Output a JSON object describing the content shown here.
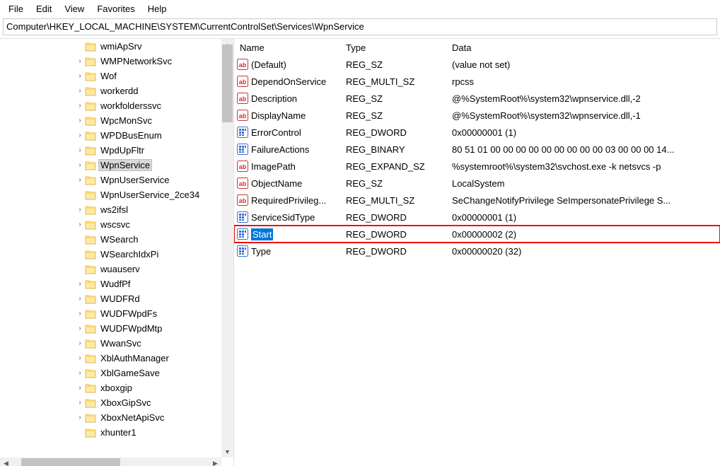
{
  "menubar": {
    "file": "File",
    "edit": "Edit",
    "view": "View",
    "favorites": "Favorites",
    "help": "Help"
  },
  "addressbar": {
    "path": "Computer\\HKEY_LOCAL_MACHINE\\SYSTEM\\CurrentControlSet\\Services\\WpnService"
  },
  "columns": {
    "name": "Name",
    "type": "Type",
    "data": "Data"
  },
  "tree": [
    {
      "label": "wmiApSrv",
      "expander": ""
    },
    {
      "label": "WMPNetworkSvc",
      "expander": ">"
    },
    {
      "label": "Wof",
      "expander": ">"
    },
    {
      "label": "workerdd",
      "expander": ">"
    },
    {
      "label": "workfolderssvc",
      "expander": ">"
    },
    {
      "label": "WpcMonSvc",
      "expander": ">"
    },
    {
      "label": "WPDBusEnum",
      "expander": ">"
    },
    {
      "label": "WpdUpFltr",
      "expander": ">"
    },
    {
      "label": "WpnService",
      "expander": ">",
      "selected": true
    },
    {
      "label": "WpnUserService",
      "expander": ">"
    },
    {
      "label": "WpnUserService_2ce34",
      "expander": ""
    },
    {
      "label": "ws2ifsl",
      "expander": ">"
    },
    {
      "label": "wscsvc",
      "expander": ">"
    },
    {
      "label": "WSearch",
      "expander": ""
    },
    {
      "label": "WSearchIdxPi",
      "expander": ""
    },
    {
      "label": "wuauserv",
      "expander": ""
    },
    {
      "label": "WudfPf",
      "expander": ">"
    },
    {
      "label": "WUDFRd",
      "expander": ">"
    },
    {
      "label": "WUDFWpdFs",
      "expander": ">"
    },
    {
      "label": "WUDFWpdMtp",
      "expander": ">"
    },
    {
      "label": "WwanSvc",
      "expander": ">"
    },
    {
      "label": "XblAuthManager",
      "expander": ">"
    },
    {
      "label": "XblGameSave",
      "expander": ">"
    },
    {
      "label": "xboxgip",
      "expander": ">"
    },
    {
      "label": "XboxGipSvc",
      "expander": ">"
    },
    {
      "label": "XboxNetApiSvc",
      "expander": ">"
    },
    {
      "label": "xhunter1",
      "expander": ""
    }
  ],
  "values": [
    {
      "name": "(Default)",
      "type": "REG_SZ",
      "data": "(value not set)",
      "icon": "ab"
    },
    {
      "name": "DependOnService",
      "type": "REG_MULTI_SZ",
      "data": "rpcss",
      "icon": "ab"
    },
    {
      "name": "Description",
      "type": "REG_SZ",
      "data": "@%SystemRoot%\\system32\\wpnservice.dll,-2",
      "icon": "ab"
    },
    {
      "name": "DisplayName",
      "type": "REG_SZ",
      "data": "@%SystemRoot%\\system32\\wpnservice.dll,-1",
      "icon": "ab"
    },
    {
      "name": "ErrorControl",
      "type": "REG_DWORD",
      "data": "0x00000001 (1)",
      "icon": "bin"
    },
    {
      "name": "FailureActions",
      "type": "REG_BINARY",
      "data": "80 51 01 00 00 00 00 00 00 00 00 00 03 00 00 00 14...",
      "icon": "bin"
    },
    {
      "name": "ImagePath",
      "type": "REG_EXPAND_SZ",
      "data": "%systemroot%\\system32\\svchost.exe -k netsvcs -p",
      "icon": "ab"
    },
    {
      "name": "ObjectName",
      "type": "REG_SZ",
      "data": "LocalSystem",
      "icon": "ab"
    },
    {
      "name": "RequiredPrivileg...",
      "type": "REG_MULTI_SZ",
      "data": "SeChangeNotifyPrivilege SeImpersonatePrivilege S...",
      "icon": "ab"
    },
    {
      "name": "ServiceSidType",
      "type": "REG_DWORD",
      "data": "0x00000001 (1)",
      "icon": "bin"
    },
    {
      "name": "Start",
      "type": "REG_DWORD",
      "data": "0x00000002 (2)",
      "icon": "bin",
      "highlight": true
    },
    {
      "name": "Type",
      "type": "REG_DWORD",
      "data": "0x00000020 (32)",
      "icon": "bin"
    }
  ]
}
